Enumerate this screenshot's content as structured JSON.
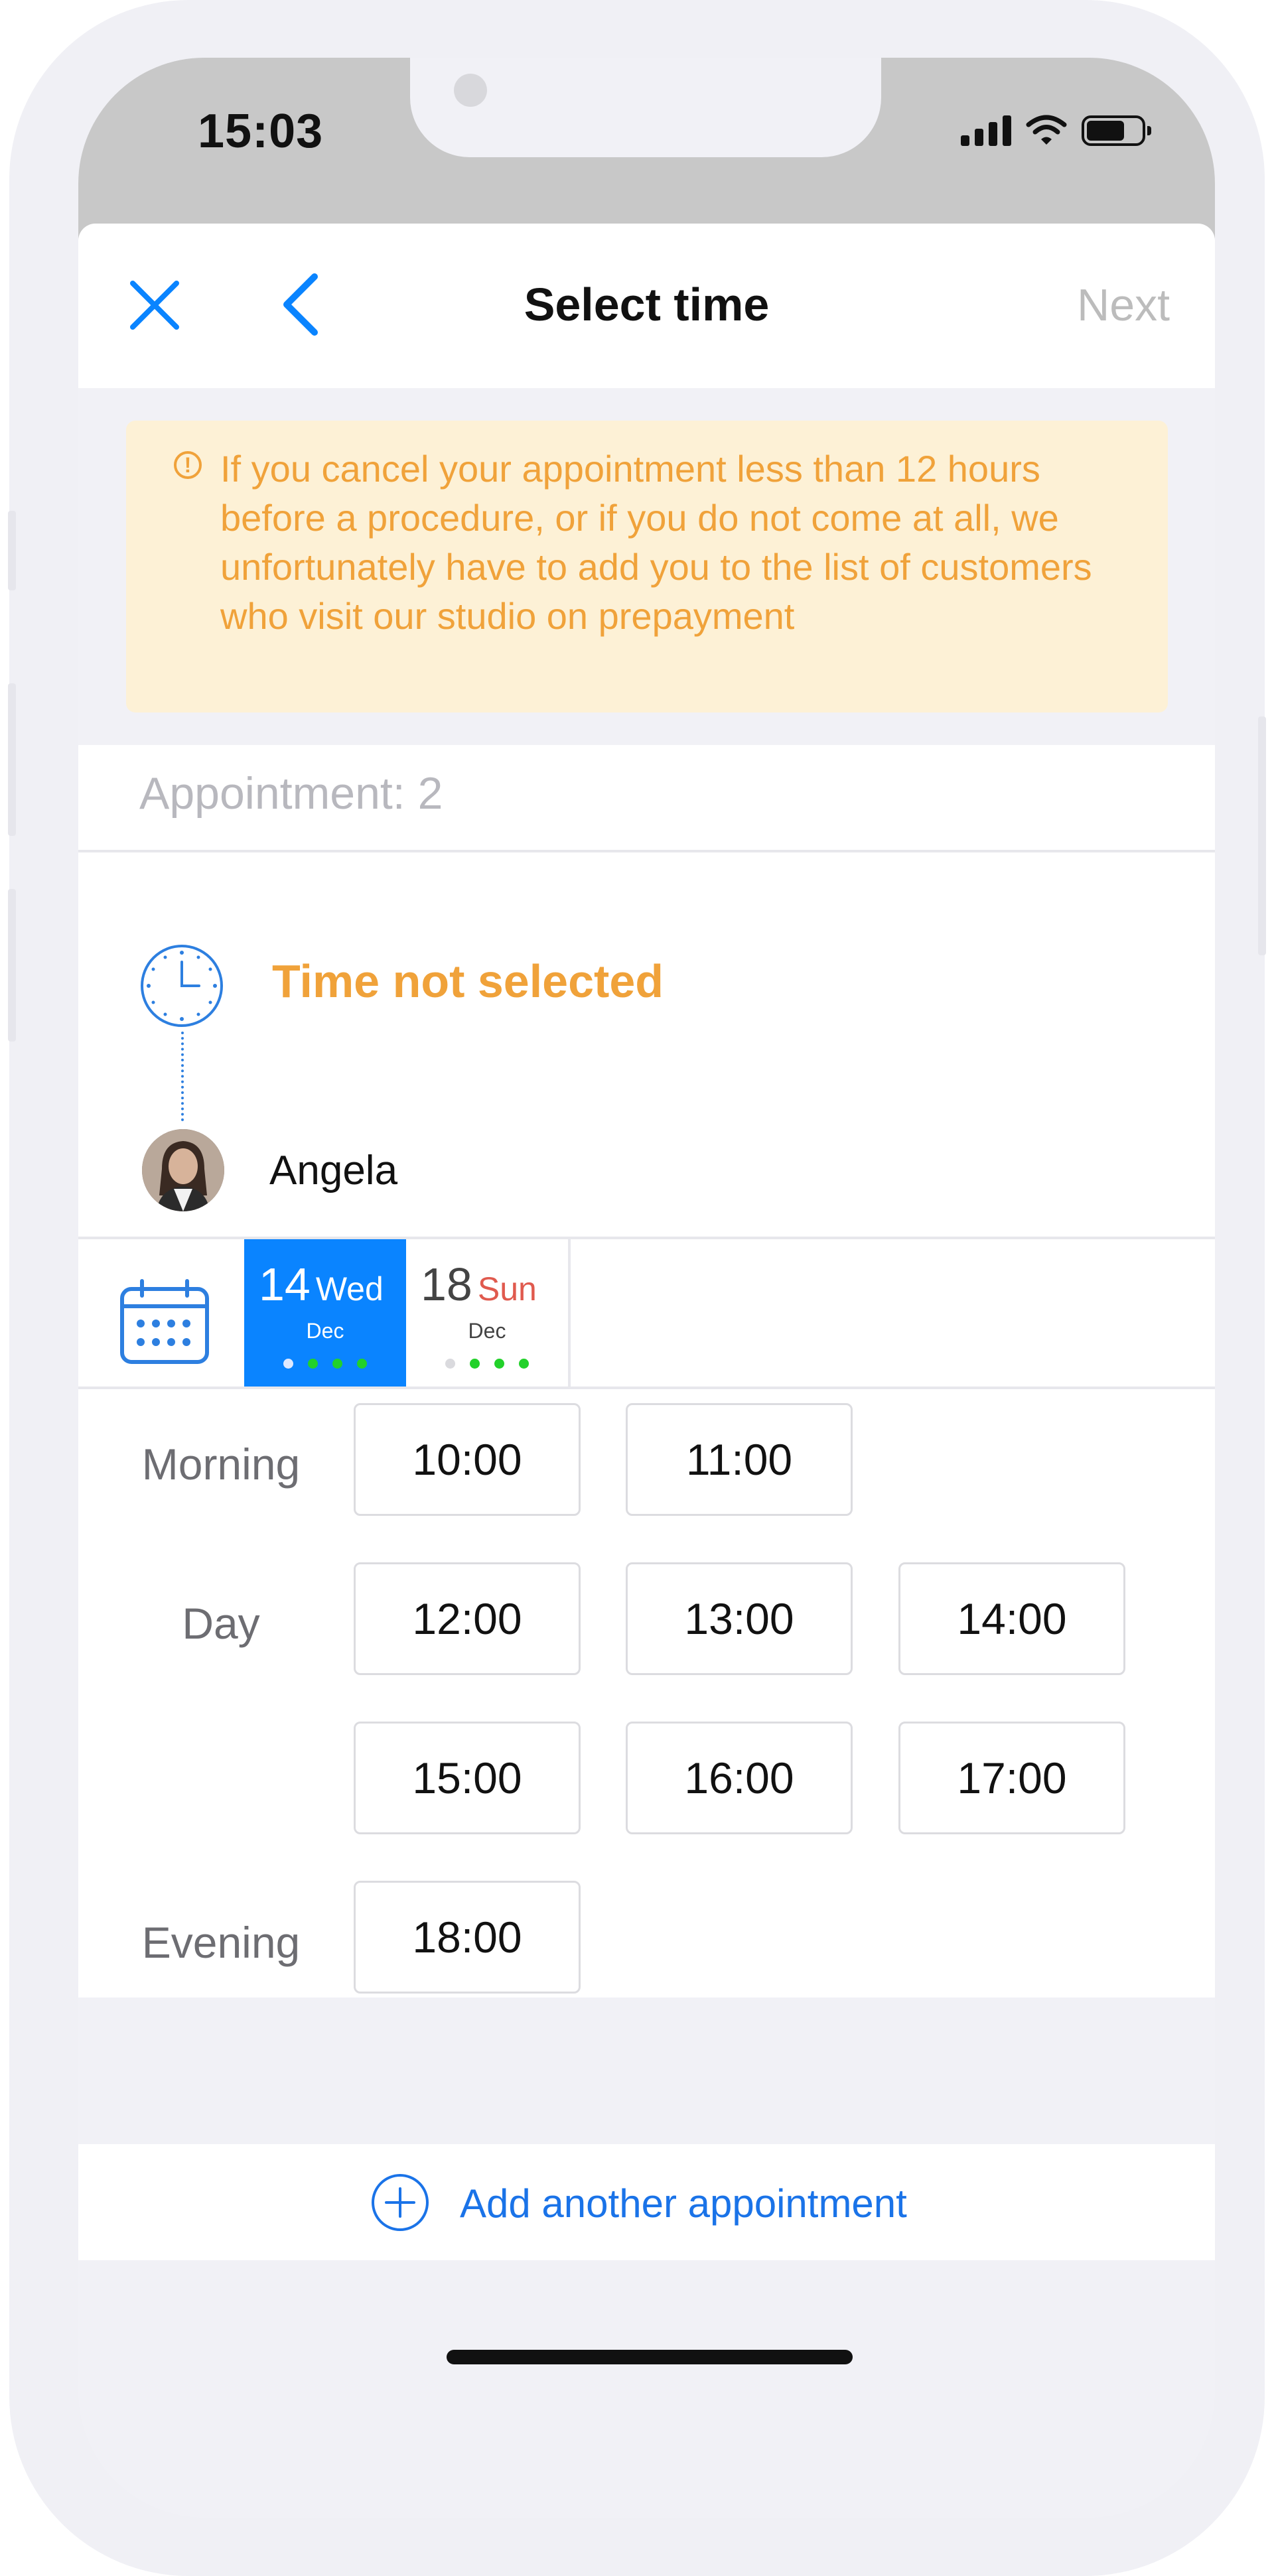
{
  "status_bar": {
    "time": "15:03",
    "signal_icon": "signal-icon",
    "wifi_icon": "wifi-icon",
    "battery_icon": "battery-icon"
  },
  "nav": {
    "title": "Select time",
    "next_label": "Next",
    "close_icon": "close-icon",
    "back_icon": "chevron-left-icon"
  },
  "warning": {
    "text": "If you cancel your appointment less than 12 hours before a procedure, or if you do not come at all, we unfortunately have to add you to the list of customers who visit our studio on prepayment"
  },
  "appointment": {
    "label": "Appointment: 2",
    "time_status": "Time not selected",
    "master_name": "Angela"
  },
  "dates": [
    {
      "day_number": "14",
      "weekday": "Wed",
      "month": "Dec",
      "selected": true
    },
    {
      "day_number": "18",
      "weekday": "Sun",
      "month": "Dec",
      "selected": false
    }
  ],
  "periods": {
    "morning": "Morning",
    "day": "Day",
    "evening": "Evening"
  },
  "slots": {
    "morning": [
      "10:00",
      "11:00"
    ],
    "day": [
      "12:00",
      "13:00",
      "14:00",
      "15:00",
      "16:00",
      "17:00"
    ],
    "evening": [
      "18:00"
    ]
  },
  "add_appointment": {
    "label": "Add another appointment"
  },
  "colors": {
    "accent": "#0a84ff",
    "warning": "#f0a23a",
    "warning_bg": "#fdf1d6",
    "available_dot": "#22d12a",
    "weekend": "#e05a4e"
  }
}
